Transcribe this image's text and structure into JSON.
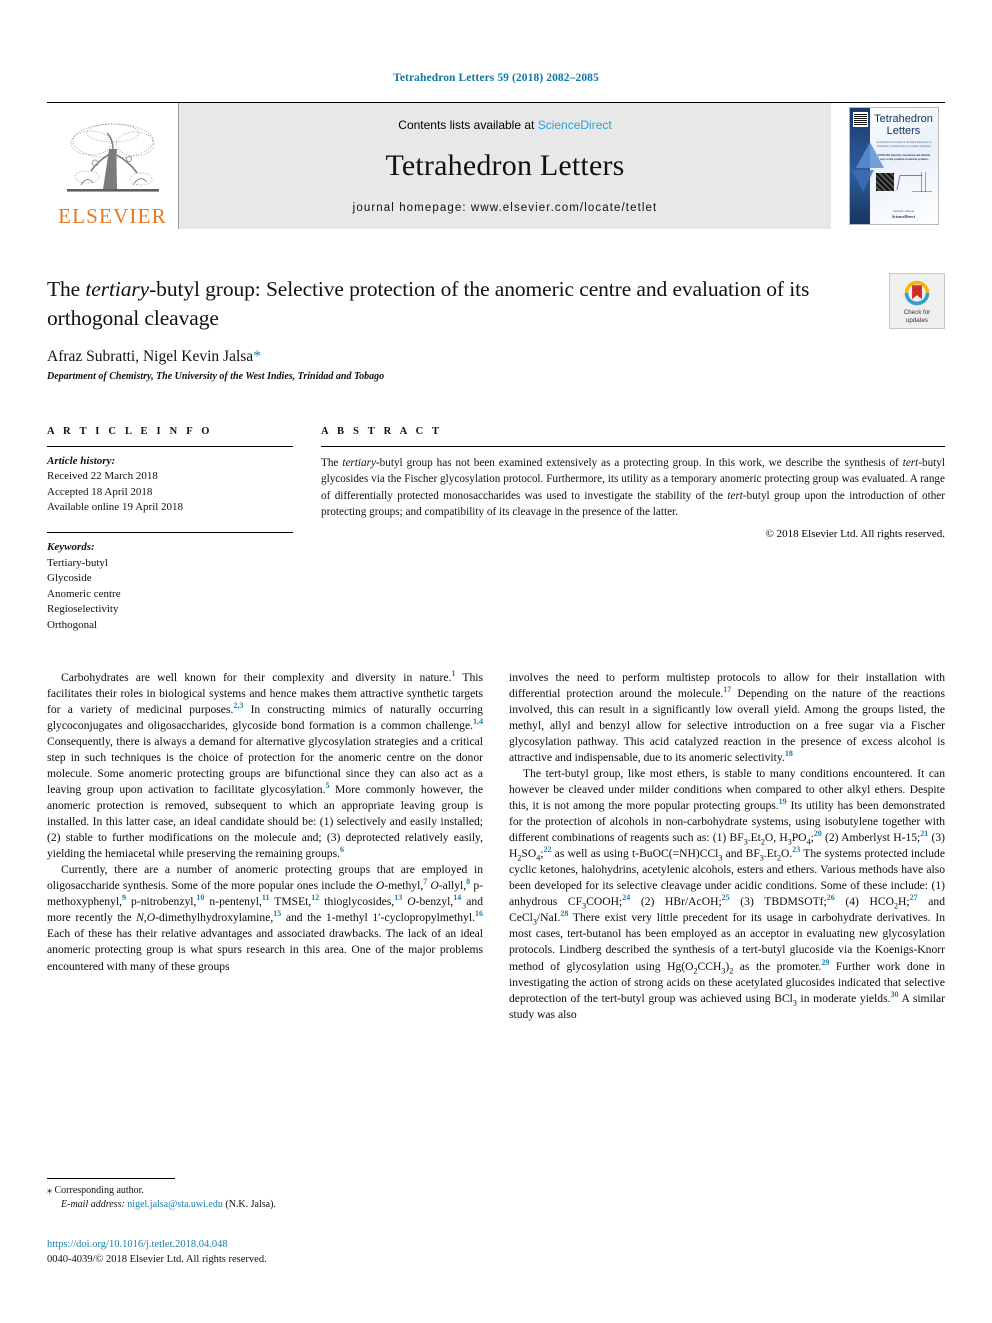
{
  "running_head": "Tetrahedron Letters 59 (2018) 2082–2085",
  "masthead": {
    "publisher_name": "ELSEVIER",
    "contents_prefix": "Contents lists available at ",
    "contents_brand": "ScienceDirect",
    "journal_title": "Tetrahedron Letters",
    "homepage": "journal homepage: www.elsevier.com/locate/tetlet",
    "cover": {
      "title_line1": "Tetrahedron",
      "title_line2": "Letters",
      "blurb": "An International Journal for the Rapid Publication of Preliminary Communications in Organic Chemistry",
      "editors": "EDITORS Selective, functional and efficient ways to the synthesis of natural products",
      "footer_small": "Available online at",
      "footer_brand": "ScienceDirect"
    }
  },
  "article": {
    "title_pre": "The ",
    "title_em": "tertiary",
    "title_post": "-butyl group: Selective protection of the anomeric centre and evaluation of its orthogonal cleavage",
    "authors": "Afraz Subratti, Nigel Kevin Jalsa",
    "author_star": "*",
    "affiliation": "Department of Chemistry, The University of the West Indies, Trinidad and Tobago",
    "crossmark_line1": "Check for",
    "crossmark_line2": "updates"
  },
  "article_info": {
    "heading": "A R T I C L E   I N F O",
    "history_label": "Article history:",
    "history": [
      "Received 22 March 2018",
      "Accepted 18 April 2018",
      "Available online 19 April 2018"
    ],
    "keywords_label": "Keywords:",
    "keywords": [
      "Tertiary-butyl",
      "Glycoside",
      "Anomeric centre",
      "Regioselectivity",
      "Orthogonal"
    ]
  },
  "abstract": {
    "heading": "A B S T R A C T",
    "paragraph_parts": [
      {
        "t": "The "
      },
      {
        "t": "tertiary",
        "i": true
      },
      {
        "t": "-butyl group has not been examined extensively as a protecting group. In this work, we describe the synthesis of "
      },
      {
        "t": "tert",
        "i": true
      },
      {
        "t": "-butyl glycosides via the Fischer glycosylation protocol. Furthermore, its utility as a temporary anomeric protecting group was evaluated. A range of differentially protected monosaccharides was used to investigate the stability of the "
      },
      {
        "t": "tert",
        "i": true
      },
      {
        "t": "-butyl group upon the introduction of other protecting groups; and compatibility of its cleavage in the presence of the latter."
      }
    ],
    "copyright": "© 2018 Elsevier Ltd. All rights reserved."
  },
  "body": {
    "left_paragraphs": [
      [
        {
          "t": "Carbohydrates are well known for their complexity and diversity in nature."
        },
        {
          "t": "1",
          "c": true
        },
        {
          "t": " This facilitates their roles in biological systems and hence makes them attractive synthetic targets for a variety of medicinal purposes."
        },
        {
          "t": "2,3",
          "c": true
        },
        {
          "t": " In constructing mimics of naturally occurring glycoconjugates and oligosaccharides, glycoside bond formation is a common challenge."
        },
        {
          "t": "1,4",
          "c": true
        },
        {
          "t": " Consequently, there is always a demand for alternative glycosylation strategies and a critical step in such techniques is the choice of protection for the anomeric centre on the donor molecule. Some anomeric protecting groups are bifunctional since they can also act as a leaving group upon activation to facilitate glycosylation."
        },
        {
          "t": "5",
          "c": true
        },
        {
          "t": " More commonly however, the anomeric protection is removed, subsequent to which an appropriate leaving group is installed. In this latter case, an ideal candidate should be: (1) selectively and easily installed; (2) stable to further modifications on the molecule and; (3) deprotected relatively easily, yielding the hemiacetal while preserving the remaining groups."
        },
        {
          "t": "6",
          "c": true
        },
        {
          "t": ""
        }
      ],
      [
        {
          "t": "Currently, there are a number of anomeric protecting groups that are employed in oligosaccharide synthesis. Some of the more popular ones include the "
        },
        {
          "t": "O",
          "i": true
        },
        {
          "t": "-methyl,"
        },
        {
          "t": "7",
          "c": true
        },
        {
          "t": " "
        },
        {
          "t": "O",
          "i": true
        },
        {
          "t": "-allyl,"
        },
        {
          "t": "8",
          "c": true
        },
        {
          "t": " p-methoxyphenyl,"
        },
        {
          "t": "9",
          "c": true
        },
        {
          "t": " p-nitrobenzyl,"
        },
        {
          "t": "10",
          "c": true
        },
        {
          "t": " n-pentenyl,"
        },
        {
          "t": "11",
          "c": true
        },
        {
          "t": " TMSEt,"
        },
        {
          "t": "12",
          "c": true
        },
        {
          "t": " thioglycosides,"
        },
        {
          "t": "13",
          "c": true
        },
        {
          "t": " "
        },
        {
          "t": "O",
          "i": true
        },
        {
          "t": "-benzyl,"
        },
        {
          "t": "14",
          "c": true
        },
        {
          "t": " and more recently the "
        },
        {
          "t": "N,O",
          "i": true
        },
        {
          "t": "-dimethylhydroxylamine,"
        },
        {
          "t": "15",
          "c": true
        },
        {
          "t": " and the 1-methyl 1′-cyclopropylmethyl."
        },
        {
          "t": "16",
          "c": true
        },
        {
          "t": " Each of these has their relative advantages and associated drawbacks. The lack of an ideal anomeric protecting group is what spurs research in this area. One of the major problems encountered with many of these groups"
        }
      ]
    ],
    "right_paragraphs": [
      [
        {
          "t": "involves the need to perform multistep protocols to allow for their installation with differential protection around the molecule."
        },
        {
          "t": "17",
          "c": true
        },
        {
          "t": " Depending on the nature of the reactions involved, this can result in a significantly low overall yield. Among the groups listed, the methyl, allyl and benzyl allow for selective introduction on a free sugar via a Fischer glycosylation pathway. This acid catalyzed reaction in the presence of excess alcohol is attractive and indispensable, due to its anomeric selectivity."
        },
        {
          "t": "18",
          "c": true
        },
        {
          "t": ""
        }
      ],
      [
        {
          "t": "The tert-butyl group, like most ethers, is stable to many conditions encountered. It can however be cleaved under milder conditions when compared to other alkyl ethers. Despite this, it is not among the more popular protecting groups."
        },
        {
          "t": "19",
          "c": true
        },
        {
          "t": " Its utility has been demonstrated for the protection of alcohols in non-carbohydrate systems, using isobutylene together with different combinations of reagents such as: (1) BF"
        },
        {
          "t": "3",
          "s": true
        },
        {
          "t": ".Et"
        },
        {
          "t": "2",
          "s": true
        },
        {
          "t": "O, H"
        },
        {
          "t": "3",
          "s": true
        },
        {
          "t": "PO"
        },
        {
          "t": "4",
          "s": true
        },
        {
          "t": ";"
        },
        {
          "t": "20",
          "c": true
        },
        {
          "t": " (2) Amberlyst H-15;"
        },
        {
          "t": "21",
          "c": true
        },
        {
          "t": " (3) H"
        },
        {
          "t": "2",
          "s": true
        },
        {
          "t": "SO"
        },
        {
          "t": "4",
          "s": true
        },
        {
          "t": ";"
        },
        {
          "t": "22",
          "c": true
        },
        {
          "t": " as well as using t-BuOC(=NH)CCl"
        },
        {
          "t": "3",
          "s": true
        },
        {
          "t": " and BF"
        },
        {
          "t": "3",
          "s": true
        },
        {
          "t": ".Et"
        },
        {
          "t": "2",
          "s": true
        },
        {
          "t": "O."
        },
        {
          "t": "23",
          "c": true
        },
        {
          "t": " The systems protected include cyclic ketones, halohydrins, acetylenic alcohols, esters and ethers. Various methods have also been developed for its selective cleavage under acidic conditions. Some of these include: (1) anhydrous CF"
        },
        {
          "t": "3",
          "s": true
        },
        {
          "t": "COOH;"
        },
        {
          "t": "24",
          "c": true
        },
        {
          "t": " (2) HBr/AcOH;"
        },
        {
          "t": "25",
          "c": true
        },
        {
          "t": " (3) TBDMSOTf;"
        },
        {
          "t": "26",
          "c": true
        },
        {
          "t": " (4) HCO"
        },
        {
          "t": "2",
          "s": true
        },
        {
          "t": "H;"
        },
        {
          "t": "27",
          "c": true
        },
        {
          "t": " and CeCl"
        },
        {
          "t": "3",
          "s": true
        },
        {
          "t": "/NaI."
        },
        {
          "t": "28",
          "c": true
        },
        {
          "t": " There exist very little precedent for its usage in carbohydrate derivatives. In most cases, tert-butanol has been employed as an acceptor in evaluating new glycosylation protocols. Lindberg described the synthesis of a tert-butyl glucoside via the Koenigs-Knorr method of glycosylation using Hg(O"
        },
        {
          "t": "2",
          "s": true
        },
        {
          "t": "CCH"
        },
        {
          "t": "3",
          "s": true
        },
        {
          "t": ")"
        },
        {
          "t": "2",
          "s": true
        },
        {
          "t": " as the promoter."
        },
        {
          "t": "29",
          "c": true
        },
        {
          "t": " Further work done in investigating the action of strong acids on these acetylated glucosides indicated that selective deprotection of the tert-butyl group was achieved using BCl"
        },
        {
          "t": "3",
          "s": true
        },
        {
          "t": " in moderate yields."
        },
        {
          "t": "30",
          "c": true
        },
        {
          "t": " A similar study was also"
        }
      ]
    ]
  },
  "footnote": {
    "star": "⁎",
    "corresponding": "Corresponding author.",
    "email_label": "E-mail address:",
    "email": "nigel.jalsa@sta.uwi.edu",
    "email_suffix": "(N.K. Jalsa)."
  },
  "footer": {
    "doi": "https://doi.org/10.1016/j.tetlet.2018.04.048",
    "issn": "0040-4039/© 2018 Elsevier Ltd. All rights reserved."
  },
  "colors": {
    "link": "#1b7fa8",
    "sciencedirect": "#2b9fd4",
    "elsevier_orange": "#E87722"
  }
}
